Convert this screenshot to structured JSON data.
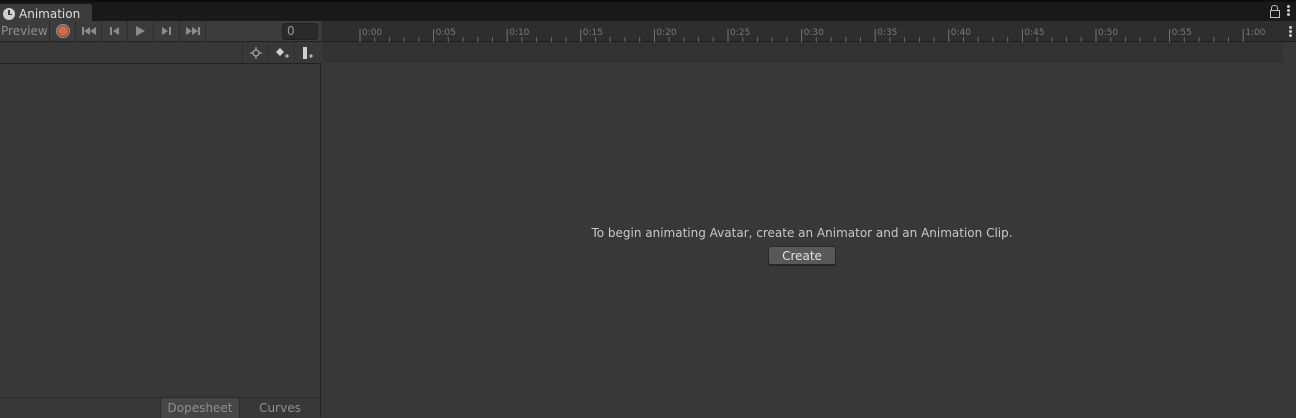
{
  "window": {
    "tab_title": "Animation",
    "tab_icon": "animation-clock-icon"
  },
  "toolbar": {
    "preview_label": "Preview",
    "frame_value": "0",
    "buttons": [
      "record-icon",
      "first-key-icon",
      "prev-key-icon",
      "play-icon",
      "next-key-icon",
      "last-key-icon"
    ]
  },
  "toolbar2": {
    "buttons": [
      "filter-by-selection-icon",
      "add-keyframe-icon",
      "add-event-icon"
    ]
  },
  "timeline": {
    "labels": [
      "0:00",
      "0:05",
      "0:10",
      "0:15",
      "0:20",
      "0:25",
      "0:30",
      "0:35",
      "0:40",
      "0:45",
      "0:50",
      "0:55",
      "1:00"
    ]
  },
  "main": {
    "message": "To begin animating Avatar, create an Animator and an Animation Clip.",
    "create_label": "Create"
  },
  "bottom_tabs": {
    "dopesheet": "Dopesheet",
    "curves": "Curves",
    "active": "Dopesheet"
  },
  "colors": {
    "background": "#383838",
    "record": "#cf6a4d",
    "titlebar": "#191919"
  }
}
